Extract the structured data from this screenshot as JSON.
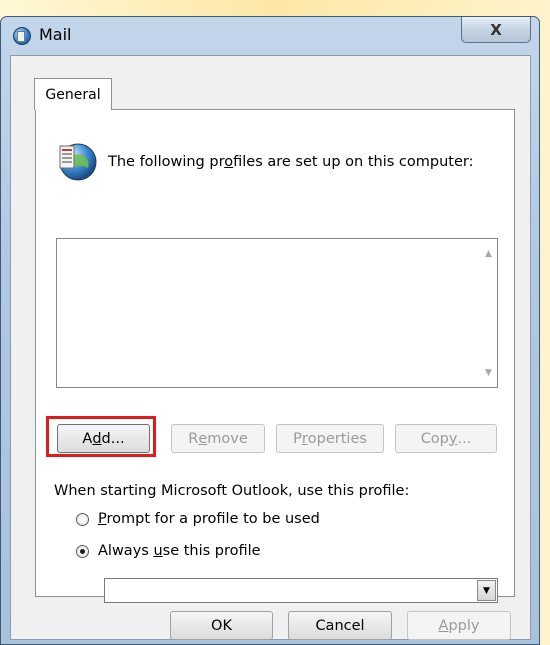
{
  "window": {
    "title": "Mail",
    "close_glyph": "X",
    "icon": "mail-control-panel-icon"
  },
  "tabs": [
    {
      "label": "General",
      "selected": true
    }
  ],
  "intro": {
    "icon": "profiles-icon",
    "text_before": "The following pr",
    "accel": "o",
    "text_after": "files are set up on this computer:"
  },
  "profiles_list": {
    "items": [],
    "scroll_up_glyph": "▲",
    "scroll_down_glyph": "▼"
  },
  "profile_buttons": {
    "add": {
      "pre": "A",
      "accel": "d",
      "post": "d...",
      "enabled": true,
      "highlighted": true
    },
    "remove": {
      "pre": "R",
      "accel": "e",
      "post": "move",
      "enabled": false
    },
    "properties": {
      "pre": "P",
      "accel": "r",
      "post": "operties",
      "enabled": false
    },
    "copy": {
      "pre": "Cop",
      "accel": "y",
      "post": "...",
      "enabled": false
    }
  },
  "startup": {
    "label": "When starting Microsoft Outlook, use this profile:",
    "options": [
      {
        "pre": "",
        "accel": "P",
        "post": "rompt for a profile to be used",
        "checked": false
      },
      {
        "pre": "Always ",
        "accel": "u",
        "post": "se this profile",
        "checked": true
      }
    ],
    "profile_select": {
      "value": "",
      "arrow_glyph": "▼"
    }
  },
  "dialog_buttons": {
    "ok": {
      "label": "OK",
      "enabled": true
    },
    "cancel": {
      "label": "Cancel",
      "enabled": true
    },
    "apply": {
      "accel": "A",
      "post": "pply",
      "enabled": false
    }
  },
  "colors": {
    "highlight_border": "#e21a1a",
    "disabled_text": "#9a9a9a"
  }
}
